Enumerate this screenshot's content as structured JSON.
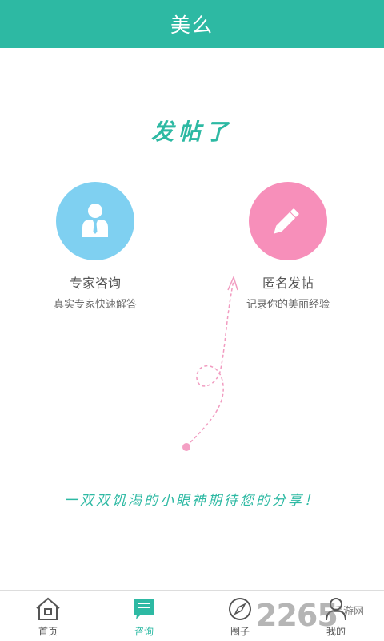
{
  "header": {
    "title": "美么"
  },
  "main": {
    "headline": "发帖了",
    "options": [
      {
        "name": "专家咨询",
        "desc": "真实专家快速解答",
        "icon": "expert-person-icon"
      },
      {
        "name": "匿名发帖",
        "desc": "记录你的美丽经验",
        "icon": "pencil-icon"
      }
    ],
    "tagline": "一双双饥渴的小眼神期待您的分享！"
  },
  "tabbar": {
    "tabs": [
      {
        "label": "首页",
        "icon": "home-icon"
      },
      {
        "label": "咨询",
        "icon": "chat-icon",
        "active": true
      },
      {
        "label": "圈子",
        "icon": "compass-icon"
      },
      {
        "label": "我的",
        "icon": "user-icon"
      }
    ]
  },
  "watermark": {
    "number": "2265",
    "site": "手游网"
  },
  "colors": {
    "brand": "#2db9a3",
    "expert": "#7fd0f1",
    "anon": "#f78fba",
    "curve": "#f19bc0"
  }
}
